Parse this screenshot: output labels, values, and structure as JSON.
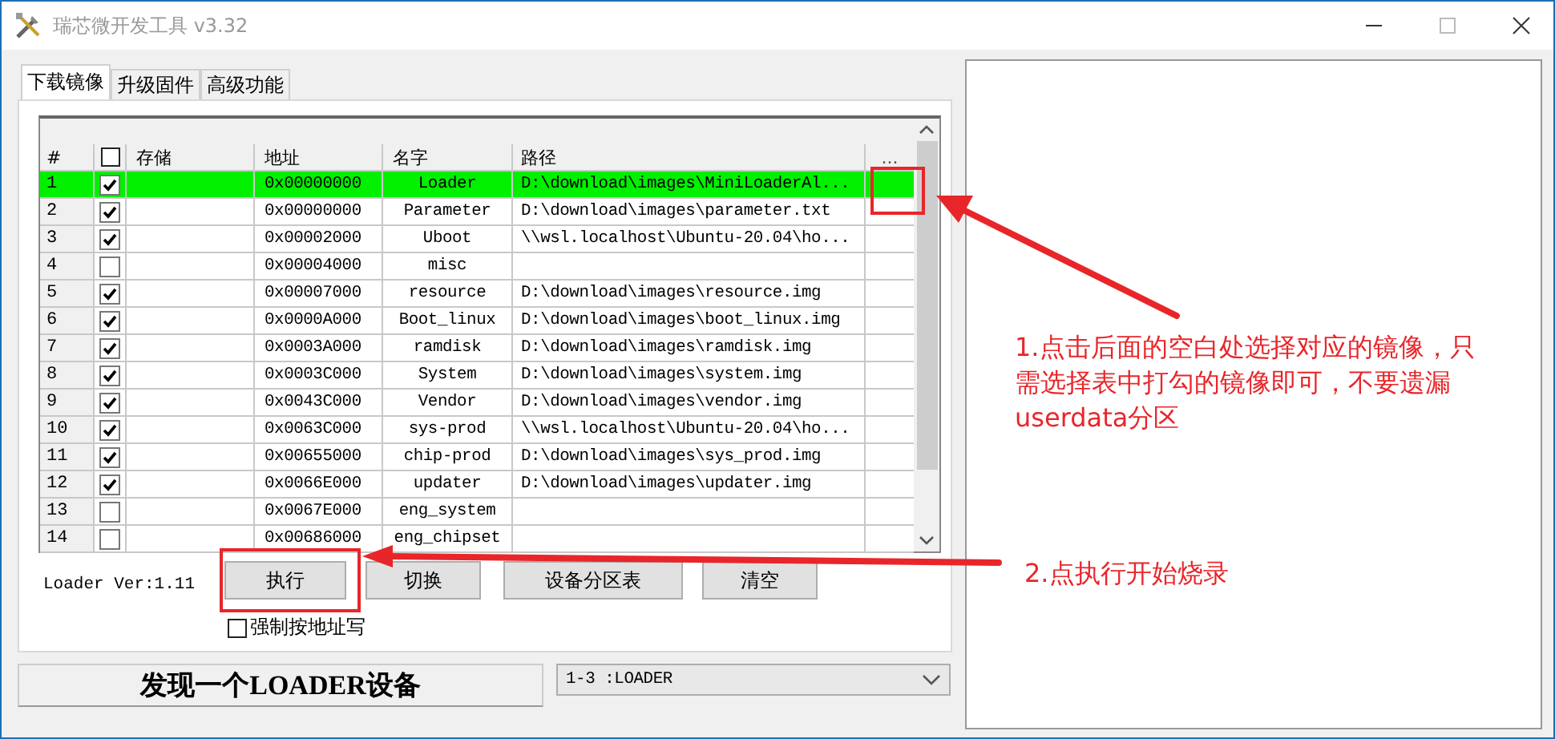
{
  "window": {
    "title": "瑞芯微开发工具 v3.32"
  },
  "tabs": [
    {
      "label": "下载镜像",
      "selected": true
    },
    {
      "label": "升级固件",
      "selected": false
    },
    {
      "label": "高级功能",
      "selected": false
    }
  ],
  "table": {
    "columns": [
      "#",
      "存储",
      "地址",
      "名字",
      "路径",
      "..."
    ],
    "header_checked": false,
    "rows": [
      {
        "index": "1",
        "checked": true,
        "selected": true,
        "address": "0x00000000",
        "name": "Loader",
        "path": "D:\\download\\images\\MiniLoaderAl..."
      },
      {
        "index": "2",
        "checked": true,
        "selected": false,
        "address": "0x00000000",
        "name": "Parameter",
        "path": "D:\\download\\images\\parameter.txt"
      },
      {
        "index": "3",
        "checked": true,
        "selected": false,
        "address": "0x00002000",
        "name": "Uboot",
        "path": "\\\\wsl.localhost\\Ubuntu-20.04\\ho..."
      },
      {
        "index": "4",
        "checked": false,
        "selected": false,
        "address": "0x00004000",
        "name": "misc",
        "path": ""
      },
      {
        "index": "5",
        "checked": true,
        "selected": false,
        "address": "0x00007000",
        "name": "resource",
        "path": "D:\\download\\images\\resource.img"
      },
      {
        "index": "6",
        "checked": true,
        "selected": false,
        "address": "0x0000A000",
        "name": "Boot_linux",
        "path": "D:\\download\\images\\boot_linux.img"
      },
      {
        "index": "7",
        "checked": true,
        "selected": false,
        "address": "0x0003A000",
        "name": "ramdisk",
        "path": "D:\\download\\images\\ramdisk.img"
      },
      {
        "index": "8",
        "checked": true,
        "selected": false,
        "address": "0x0003C000",
        "name": "System",
        "path": "D:\\download\\images\\system.img"
      },
      {
        "index": "9",
        "checked": true,
        "selected": false,
        "address": "0x0043C000",
        "name": "Vendor",
        "path": "D:\\download\\images\\vendor.img"
      },
      {
        "index": "10",
        "checked": true,
        "selected": false,
        "address": "0x0063C000",
        "name": "sys-prod",
        "path": "\\\\wsl.localhost\\Ubuntu-20.04\\ho..."
      },
      {
        "index": "11",
        "checked": true,
        "selected": false,
        "address": "0x00655000",
        "name": "chip-prod",
        "path": "D:\\download\\images\\sys_prod.img"
      },
      {
        "index": "12",
        "checked": true,
        "selected": false,
        "address": "0x0066E000",
        "name": "updater",
        "path": "D:\\download\\images\\updater.img"
      },
      {
        "index": "13",
        "checked": false,
        "selected": false,
        "address": "0x0067E000",
        "name": "eng_system",
        "path": ""
      },
      {
        "index": "14",
        "checked": false,
        "selected": false,
        "address": "0x00686000",
        "name": "eng_chipset",
        "path": ""
      }
    ]
  },
  "loader_version": "Loader Ver:1.11",
  "buttons": [
    "执行",
    "切换",
    "设备分区表",
    "清空"
  ],
  "force_address_write": {
    "label": "强制按地址写",
    "checked": false
  },
  "status": "发现一个LOADER设备",
  "device_dropdown": {
    "value": "1-3 :LOADER"
  },
  "annotations": [
    "1.点击后面的空白处选择对应的镜像，只需选择表中打勾的镜像即可，不要遗漏userdata分区",
    "2.点执行开始烧录"
  ]
}
